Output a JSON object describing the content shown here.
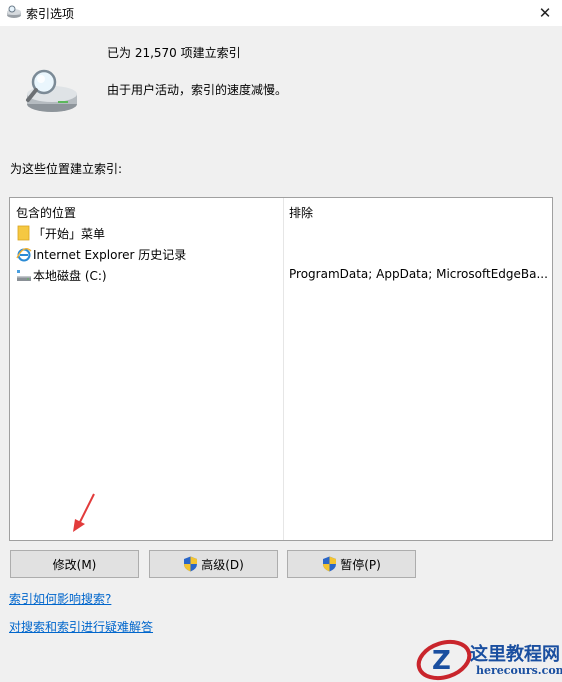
{
  "window": {
    "title": "索引选项",
    "close_glyph": "✕"
  },
  "status": {
    "indexed_count": "已为 21,570 项建立索引",
    "note": "由于用户活动，索引的速度减慢。"
  },
  "locations_label": "为这些位置建立索引:",
  "table": {
    "columns": [
      "包含的位置",
      "排除"
    ],
    "rows": [
      {
        "name": "「开始」菜单",
        "excluded": "",
        "icon": "folder-icon"
      },
      {
        "name": "Internet Explorer 历史记录",
        "excluded": "",
        "icon": "internet-explorer-icon"
      },
      {
        "name": "本地磁盘 (C:)",
        "excluded": "ProgramData; AppData; MicrosoftEdgeBa...",
        "icon": "drive-icon"
      }
    ]
  },
  "buttons": {
    "modify": "修改(M)",
    "advanced": "高级(D)",
    "pause": "暂停(P)"
  },
  "links": {
    "how_indexing_affects": "索引如何影响搜索?",
    "troubleshoot": "对搜索和索引进行疑难解答"
  },
  "watermark": {
    "brand": "这里教程网",
    "url": "herecours.com",
    "mark": "Z"
  },
  "colors": {
    "window_bg": "#f0f0f0",
    "link": "#0066cc",
    "folder": "#f5c842",
    "arrow": "#e23b3b",
    "watermark_red": "#c9252c",
    "watermark_blue": "#1a4fa0"
  }
}
